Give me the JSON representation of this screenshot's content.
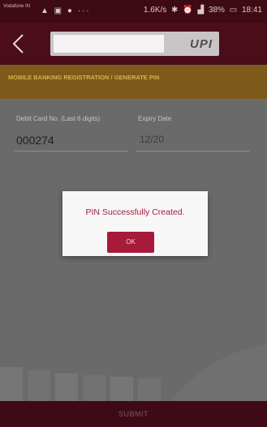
{
  "status_bar": {
    "carrier": "Vodafone IN",
    "left_icons": "▲ ▣ ● ···",
    "network_speed": "1.6K/s",
    "battery": "38%",
    "time": "18:41"
  },
  "app_bar": {
    "logo_text": "UPI",
    "back_icon": "chevron-left-icon"
  },
  "section": {
    "title": "MOBILE BANKING REGISTRATION / GENERATE PIN"
  },
  "form": {
    "debit_card_label": "Debit Card No. (Last 6 digits)",
    "debit_card_value": "000274",
    "expiry_label": "Expiry Date",
    "expiry_value": "12/20"
  },
  "submit": {
    "label": "SUBMIT"
  },
  "dialog": {
    "message": "PIN Successfully Created.",
    "ok_label": "OK"
  },
  "colors": {
    "primary": "#4a0d19",
    "accent": "#a71a3a",
    "banner": "#7d5a1a"
  }
}
